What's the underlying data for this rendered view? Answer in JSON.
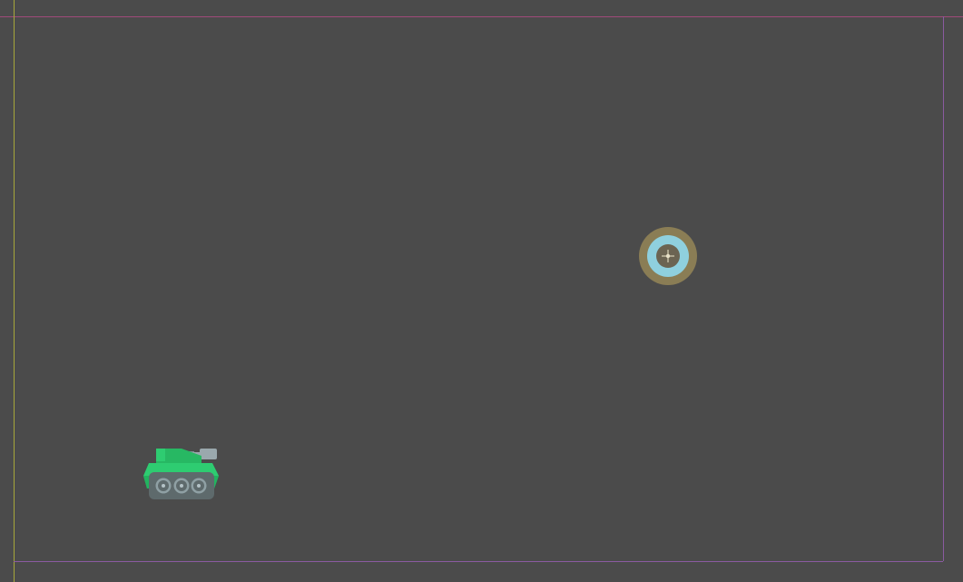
{
  "scene": {
    "background_color": "#4b4b4b",
    "guide_colors": {
      "top": "#a04a7a",
      "left": "#a8a83a",
      "frame": "#8a5aa0"
    }
  },
  "target": {
    "icon": "target-icon",
    "outer_color": "#8a7d55",
    "ring_color": "#8fd0de",
    "center_color": "#6b6452"
  },
  "tank": {
    "icon": "tank-icon",
    "body_color": "#2ecc71",
    "turret_color": "#27b863",
    "barrel_color": "#9aa8ad",
    "track_color": "#5e6a6c",
    "wheel_color": "#8fa0a4"
  }
}
